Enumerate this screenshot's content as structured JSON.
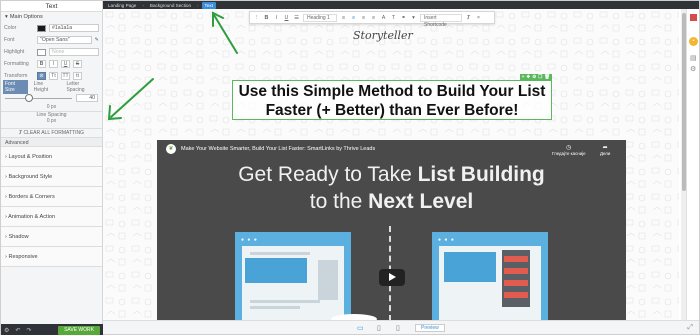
{
  "panel": {
    "title": "Text",
    "section_main": "Main Options",
    "color_label": "Color",
    "color_value": "#1a1a1a",
    "color_hex": "#1a1a1a",
    "font_label": "Font",
    "font_value": "\"Open Sans\"",
    "highlight_label": "Highlight",
    "highlight_value": "None",
    "formatting_label": "Formatting",
    "transform_label": "Transform",
    "format_buttons": [
      "B",
      "I",
      "U",
      "S"
    ],
    "transform_buttons": [
      "Tt",
      "TT",
      "tt"
    ],
    "tabs": [
      "Font Size",
      "Line Height",
      "Letter Spacing"
    ],
    "font_size_value": "40",
    "small_value_1": "0 px",
    "line_spacing_label": "Line Spacing",
    "small_value_2": "0 px",
    "clear_formatting": "CLEAR ALL FORMATTING",
    "advanced": "Advanced",
    "accordions": [
      "Layout & Position",
      "Background Style",
      "Borders & Corners",
      "Animation & Action",
      "Shadow",
      "Responsive"
    ],
    "save_label": "SAVE WORK"
  },
  "topbar": {
    "crumbs": [
      "Landing Page",
      "Background Section",
      "Text"
    ]
  },
  "toolbar": {
    "heading_select": "Heading 1",
    "shortcode_select": "Insert Shortcode"
  },
  "canvas": {
    "logo": "Storyteller",
    "headline_line1": "Use this Simple Method to Build Your List",
    "headline_line2": "Faster (+ Better) than Ever Before!"
  },
  "video": {
    "title": "Make Your Website Smarter, Build Your List Faster: SmartLinks by Thrive Leads",
    "watch_later": "Гледајте касније",
    "share": "Дели",
    "line1_normal": "Get Ready to Take ",
    "line1_bold": "List Building",
    "line2_normal": "to the ",
    "line2_bold": "Next Level"
  },
  "bottombar": {
    "preview": "Preview"
  },
  "colors": {
    "accent_blue": "#3a8cd9",
    "save_green": "#58a83b",
    "selection_green": "#5cb85c",
    "annotation_arrow": "#2e9d3e"
  }
}
